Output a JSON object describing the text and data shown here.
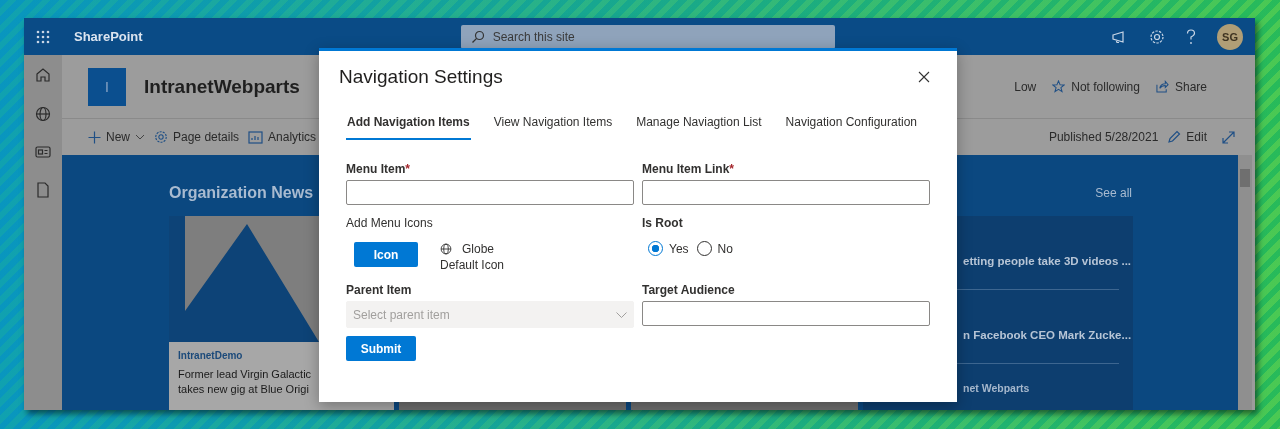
{
  "app_bar": {
    "title": "SharePoint",
    "search": {
      "placeholder": "Search this site"
    },
    "avatar": "SG"
  },
  "site": {
    "logo_letter": "I",
    "title": "IntranetWebparts",
    "actions": [
      {
        "kind": "text",
        "label": "Low"
      },
      {
        "kind": "follow",
        "label": "Not following"
      },
      {
        "kind": "share",
        "label": "Share"
      }
    ]
  },
  "command_bar": {
    "items": [
      {
        "kind": "new",
        "label": "New"
      },
      {
        "kind": "details",
        "label": "Page details"
      },
      {
        "kind": "analytics",
        "label": "Analytics"
      }
    ],
    "published": "Published 5/28/2021",
    "edit": "Edit"
  },
  "news": {
    "title": "Organization News",
    "see_all": "See all",
    "card": {
      "source": "IntranetDemo",
      "title": "Former lead Virgin Galactic takes new gig at Blue Origi"
    },
    "side_items": [
      {
        "kind": "title",
        "text": "etting people take 3D videos ..."
      },
      {
        "kind": "title",
        "text": "n Facebook CEO Mark Zucke..."
      },
      {
        "kind": "source",
        "text": "net Webparts"
      }
    ]
  },
  "modal": {
    "title": "Navigation Settings",
    "tabs": [
      {
        "label": "Add Navigation Items",
        "selected": true
      },
      {
        "label": "View Navigation Items",
        "selected": false
      },
      {
        "label": "Manage Naviagtion List",
        "selected": false
      },
      {
        "label": "Navigation Configuration",
        "selected": false
      }
    ],
    "menu_item": {
      "label": "Menu Item",
      "required_mark": "*"
    },
    "menu_item_link": {
      "label": "Menu Item Link",
      "required_mark": "*"
    },
    "menu_icons": {
      "label": "Add Menu Icons",
      "button": "Icon",
      "icon_name": "Globe",
      "icon_caption": "Default Icon"
    },
    "is_root": {
      "label": "Is Root",
      "options": [
        {
          "label": "Yes",
          "selected": true
        },
        {
          "label": "No",
          "selected": false
        }
      ]
    },
    "parent_item": {
      "label": "Parent Item",
      "placeholder": "Select parent item",
      "disabled": true
    },
    "target_audience": {
      "label": "Target Audience"
    },
    "submit": "Submit"
  }
}
